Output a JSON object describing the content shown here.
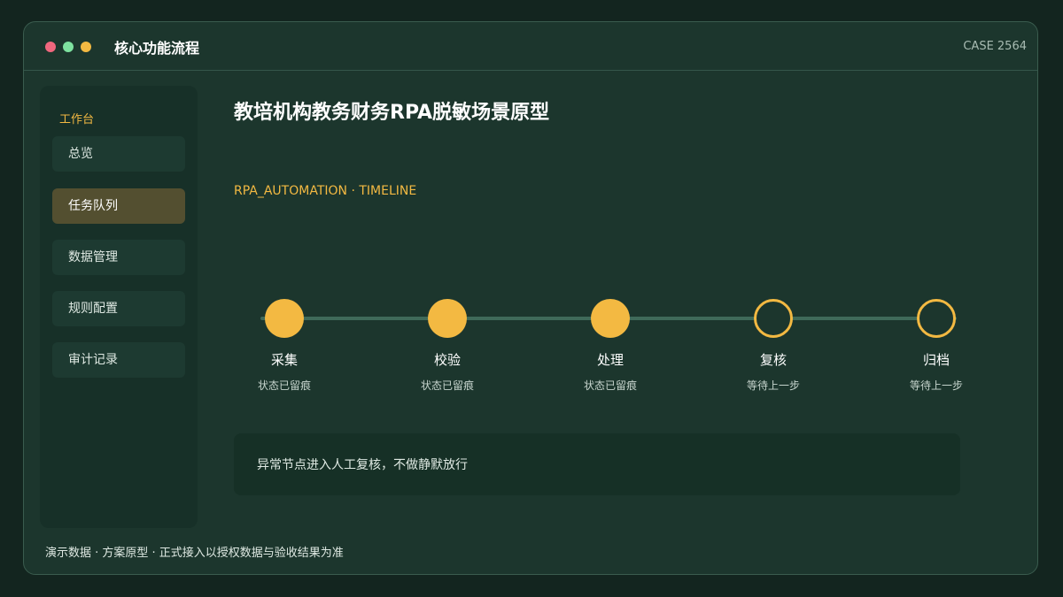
{
  "window": {
    "title": "核心功能流程",
    "case_id": "CASE 2564",
    "controls": [
      "close-dot",
      "maximize-dot",
      "minimize-dot"
    ]
  },
  "sidebar": {
    "heading": "工作台",
    "items": [
      {
        "label": "总览",
        "active": false
      },
      {
        "label": "任务队列",
        "active": true
      },
      {
        "label": "数据管理",
        "active": false
      },
      {
        "label": "规则配置",
        "active": false
      },
      {
        "label": "审计记录",
        "active": false
      }
    ]
  },
  "main": {
    "title": "教培机构教务财务RPA脱敏场景原型",
    "subtitle": "RPA_AUTOMATION · TIMELINE",
    "steps": [
      {
        "label": "采集",
        "status": "状态已留痕",
        "state": "done"
      },
      {
        "label": "校验",
        "status": "状态已留痕",
        "state": "done"
      },
      {
        "label": "处理",
        "status": "状态已留痕",
        "state": "done"
      },
      {
        "label": "复核",
        "status": "等待上一步",
        "state": "pending"
      },
      {
        "label": "归档",
        "status": "等待上一步",
        "state": "pending"
      }
    ],
    "notice": "异常节点进入人工复核，不做静默放行"
  },
  "footer": "演示数据 · 方案原型 · 正式接入以授权数据与验收结果为准",
  "colors": {
    "accent": "#f3b942",
    "background": "#13251f",
    "panel": "#1c362d",
    "active_nav": "#534f30"
  }
}
